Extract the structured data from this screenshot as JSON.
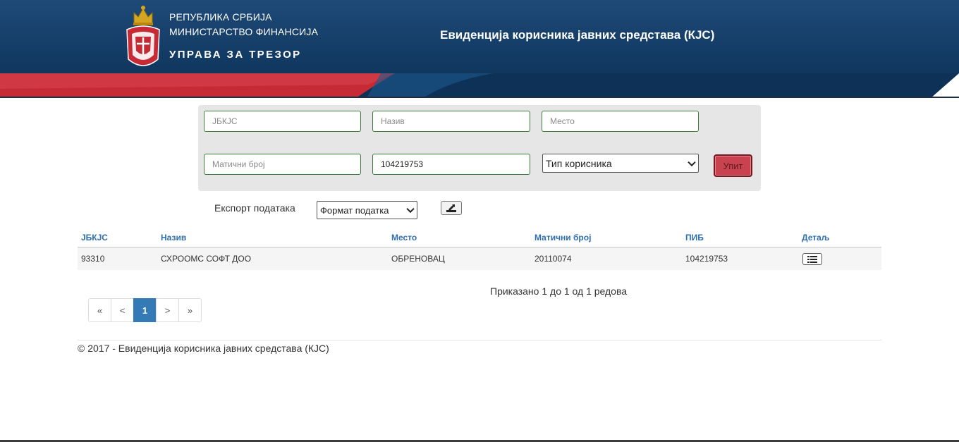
{
  "header": {
    "line1": "РЕПУБЛИКА СРБИЈА",
    "line2": "МИНИСТАРСТВО ФИНАНСИЈА",
    "line3": "УПРАВА ЗА ТРЕЗОР",
    "app_title": "Евиденција корисника јавних средстава (КЈС)",
    "colors": {
      "navy": "#123a63",
      "red": "#c62a35",
      "white": "#ffffff"
    }
  },
  "search": {
    "jbkjc": {
      "placeholder": "ЈБКЈС",
      "value": ""
    },
    "naziv": {
      "placeholder": "Назив",
      "value": ""
    },
    "mesto": {
      "placeholder": "Место",
      "value": ""
    },
    "maticni_broj": {
      "placeholder": "Матични број",
      "value": ""
    },
    "pib": {
      "placeholder": "",
      "value": "104219753"
    },
    "tip_korisnika": "Тип корисника",
    "submit_label": "Упит"
  },
  "export": {
    "label": "Експорт података",
    "format_select": "Формат податка",
    "button_icon": "export-icon"
  },
  "table": {
    "headers": [
      "ЈБКЈС",
      "Назив",
      "Место",
      "Матични број",
      "ПИБ",
      "Детаљ"
    ],
    "rows": [
      {
        "jbkjc": "93310",
        "naziv": "СХРООМС СОФТ ДОО",
        "mesto": "ОБРЕНОВАЦ",
        "maticni_broj": "20110074",
        "pib": "104219753",
        "detail_icon": "list-icon"
      }
    ]
  },
  "summary": "Приказано 1 до 1 од 1 редова",
  "pagination": {
    "first": "«",
    "prev": "<",
    "current": "1",
    "next": ">",
    "last": "»"
  },
  "footer": "© 2017 - Евиденција корисника јавних средстава (КЈС)"
}
